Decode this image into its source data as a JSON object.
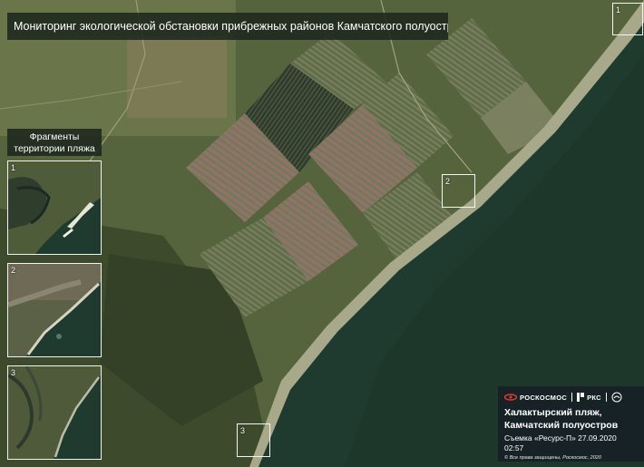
{
  "header": {
    "title": "Мониторинг экологической обстановки прибрежных районов Камчатского полуострова"
  },
  "fragments": {
    "label_line1": "Фрагменты",
    "label_line2": "территории пляжа",
    "items": [
      {
        "number": "1"
      },
      {
        "number": "2"
      },
      {
        "number": "3"
      }
    ]
  },
  "map_markers": [
    {
      "number": "1"
    },
    {
      "number": "2"
    },
    {
      "number": "3"
    }
  ],
  "info_panel": {
    "logo_roscosmos": "РОСКОСМОС",
    "logo_rks": "РКС",
    "location_line1": "Халактырский пляж,",
    "location_line2": "Камчатский полуостров",
    "capture": "Съемка «Ресурс-П» 27.09.2020 02:57",
    "rights": "© Все права защищены, Роскосмос, 2020",
    "panel_color": "#16202a"
  },
  "colors": {
    "ocean": "#1f3a2e",
    "land": "#5d6b42",
    "forest": "#3e4a2c",
    "field_pink": "#8c6e64"
  }
}
